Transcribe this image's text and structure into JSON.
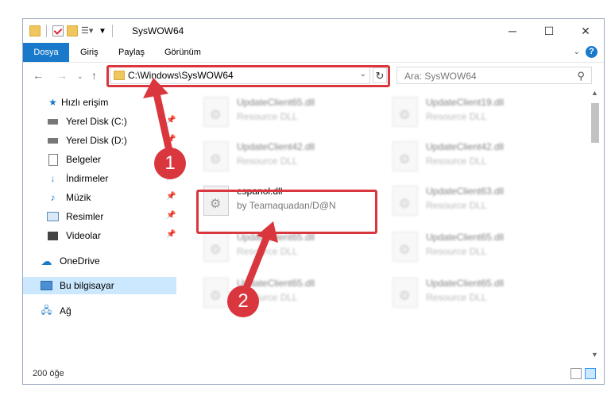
{
  "window": {
    "title": "SysWOW64"
  },
  "ribbon": {
    "tabs": [
      "Dosya",
      "Giriş",
      "Paylaş",
      "Görünüm"
    ],
    "help": "?"
  },
  "address": {
    "path": "C:\\Windows\\SysWOW64"
  },
  "search": {
    "placeholder": "Ara: SysWOW64"
  },
  "sidebar": {
    "items": [
      {
        "label": "Hızlı erişim"
      },
      {
        "label": "Yerel Disk (C:)"
      },
      {
        "label": "Yerel Disk (D:)"
      },
      {
        "label": "Belgeler"
      },
      {
        "label": "İndirmeler"
      },
      {
        "label": "Müzik"
      },
      {
        "label": "Resimler"
      },
      {
        "label": "Videolar"
      },
      {
        "label": "OneDrive"
      },
      {
        "label": "Bu bilgisayar"
      },
      {
        "label": "Ağ"
      }
    ]
  },
  "files": [
    {
      "name": "UpdateClient65.dll",
      "sub": "Resource DLL"
    },
    {
      "name": "UpdateClient19.dll",
      "sub": "Resource DLL"
    },
    {
      "name": "UpdateClient42.dll",
      "sub": "Resource DLL"
    },
    {
      "name": "UpdateClient42.dll",
      "sub": "Resource DLL"
    },
    {
      "name": "espanol.dll",
      "sub": "by Teamaquadan/D@N"
    },
    {
      "name": "UpdateClient63.dll",
      "sub": "Resource DLL"
    },
    {
      "name": "UpdateClient65.dll",
      "sub": "Resource DLL"
    },
    {
      "name": "UpdateClient65.dll",
      "sub": "Resource DLL"
    },
    {
      "name": "UpdateClient65.dll",
      "sub": "Resource DLL"
    },
    {
      "name": "UpdateClient65.dll",
      "sub": "Resource DLL"
    }
  ],
  "status": {
    "count": "200 öğe"
  },
  "annotations": {
    "badge1": "1",
    "badge2": "2"
  },
  "colors": {
    "accent": "#1979ca",
    "highlight": "#d9363e",
    "selected": "#cce8ff"
  }
}
